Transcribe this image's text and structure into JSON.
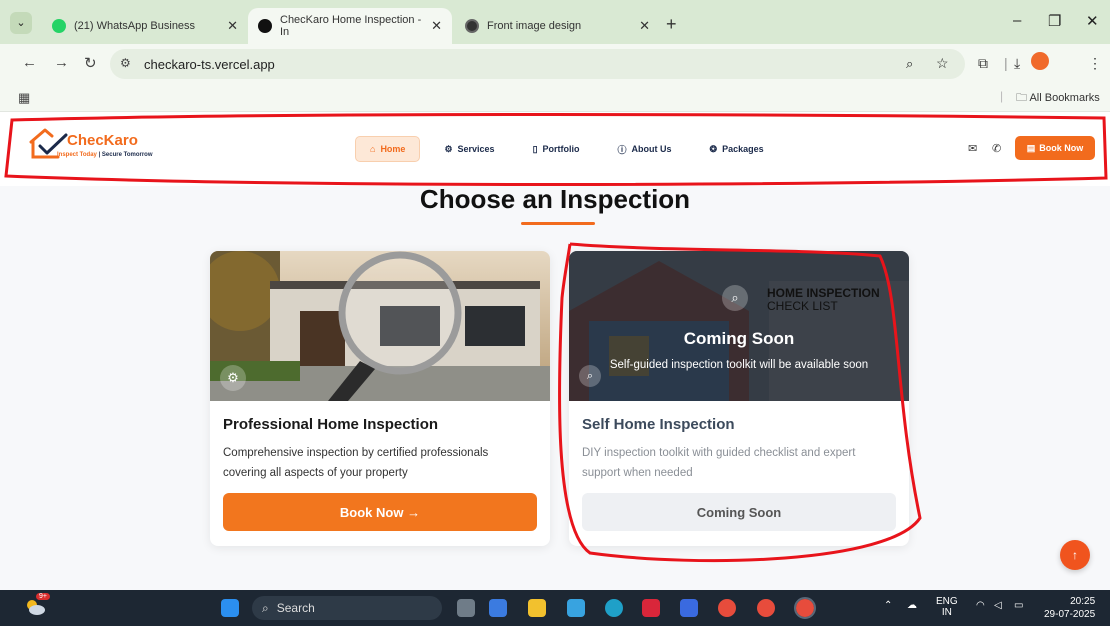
{
  "browser": {
    "tabs": [
      {
        "title": "(21) WhatsApp Business",
        "color": "#25d366"
      },
      {
        "title": "ChecKaro Home Inspection - In",
        "color": "#111111"
      },
      {
        "title": "Front image design",
        "color": "#333333"
      }
    ],
    "url": "checkaro-ts.vercel.app",
    "bookmarks_label": "All Bookmarks"
  },
  "header": {
    "logo_name": "ChecKaro",
    "logo_tag_a": "Inspect Today",
    "logo_tag_sep": " | ",
    "logo_tag_b": "Secure Tomorrow",
    "nav": [
      "Home",
      "Services",
      "Portfolio",
      "About Us",
      "Packages"
    ],
    "book_label": "Book Now"
  },
  "section_title": "Choose an Inspection",
  "cards": [
    {
      "title": "Professional Home Inspection",
      "desc": "Comprehensive inspection by certified professionals covering all aspects of your property",
      "button": "Book Now →"
    },
    {
      "title": "Self Home Inspection",
      "desc": "DIY inspection toolkit with guided checklist and expert support when needed",
      "button": "Coming Soon",
      "overlay_title": "Coming Soon",
      "overlay_sub": "Self-guided inspection toolkit will be available soon",
      "sign_line1": "HOME INSPECTION",
      "sign_line2": "CHECK LIST"
    }
  ],
  "taskbar": {
    "search": "Search",
    "lang1": "ENG",
    "lang2": "IN",
    "time": "20:25",
    "date": "29-07-2025",
    "weather_badge": "9+"
  },
  "colors": {
    "brand": "#f26b1d",
    "annotation": "#e8141b"
  }
}
